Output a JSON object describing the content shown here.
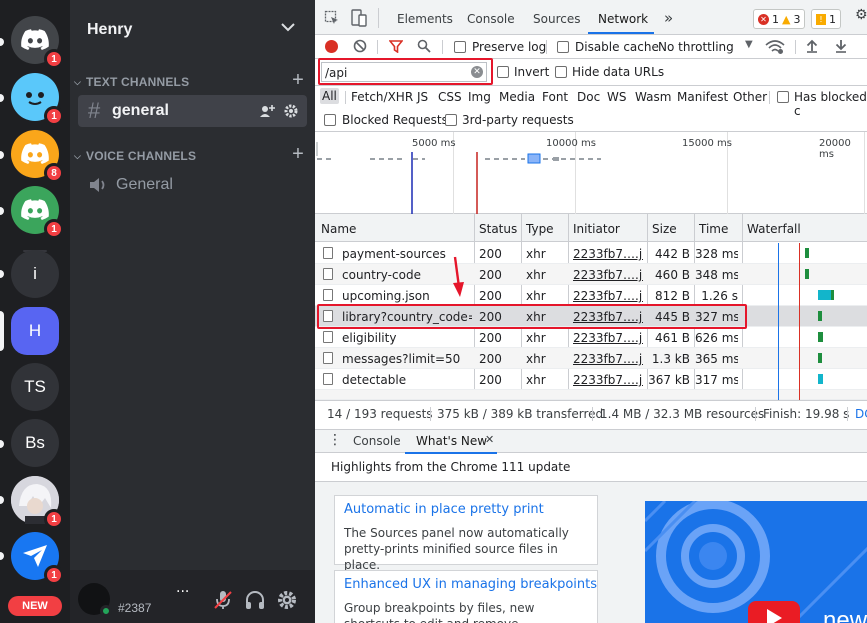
{
  "colors": {
    "discord_rail": "#1e1f22",
    "discord_sidebar": "#2b2d31",
    "discord_blurple": "#5865f2",
    "badge_red": "#f23f43",
    "devtools_accent": "#1a73e8",
    "annotation_red": "#e5162b"
  },
  "servers": [
    {
      "kind": "discord-logo",
      "color": "#424549",
      "badge": "1"
    },
    {
      "kind": "smiley",
      "color": "#5ac8fa",
      "badge": "1"
    },
    {
      "kind": "discord-logo",
      "color": "#faa61a",
      "badge": "8"
    },
    {
      "kind": "discord-logo",
      "color": "#3ba55c",
      "badge": "1"
    },
    {
      "kind": "text",
      "label": "i",
      "color": "#313338"
    },
    {
      "kind": "text",
      "label": "H",
      "color": "#5865f2",
      "selected": true
    },
    {
      "kind": "text",
      "label": "TS",
      "color": "#313338"
    },
    {
      "kind": "text",
      "label": "Bs",
      "color": "#313338"
    },
    {
      "kind": "anime-avatar",
      "color": "#c8c8d0",
      "badge": "1"
    },
    {
      "kind": "bird-logo",
      "color": "#1877f2",
      "badge": "1"
    }
  ],
  "new_label": "NEW",
  "guild": {
    "name": "Henry"
  },
  "categories": {
    "text": "TEXT CHANNELS",
    "voice": "VOICE CHANNELS"
  },
  "channels": {
    "text": "general",
    "voice": "General"
  },
  "user": {
    "tag": "#2387",
    "more": "···"
  },
  "devtools": {
    "tabs": [
      "Elements",
      "Console",
      "Sources",
      "Network"
    ],
    "more_tabs": "»",
    "counters": {
      "errors": "1",
      "warnings": "3",
      "info": "1"
    },
    "toolbar": {
      "preserve_log": "Preserve log",
      "disable_cache": "Disable cache",
      "throttling": "No throttling"
    },
    "filter": {
      "value": "/api",
      "invert": "Invert",
      "hide_data_urls": "Hide data URLs"
    },
    "types": [
      "All",
      "Fetch/XHR",
      "JS",
      "CSS",
      "Img",
      "Media",
      "Font",
      "Doc",
      "WS",
      "Wasm",
      "Manifest",
      "Other"
    ],
    "has_blocked": "Has blocked c",
    "blocked_requests": "Blocked Requests",
    "third_party": "3rd-party requests",
    "overview_ticks": [
      "5000 ms",
      "10000 ms",
      "15000 ms",
      "20000 ms"
    ],
    "columns": [
      "Name",
      "Status",
      "Type",
      "Initiator",
      "Size",
      "Time",
      "Waterfall"
    ],
    "rows": [
      {
        "name": "payment-sources",
        "status": "200",
        "type": "xhr",
        "initiator": "2233fb7….j…",
        "size": "442 B",
        "time": "328 ms"
      },
      {
        "name": "country-code",
        "status": "200",
        "type": "xhr",
        "initiator": "2233fb7….j…",
        "size": "460 B",
        "time": "348 ms"
      },
      {
        "name": "upcoming.json",
        "status": "200",
        "type": "xhr",
        "initiator": "2233fb7….j…",
        "size": "812 B",
        "time": "1.26 s"
      },
      {
        "name": "library?country_code=…",
        "status": "200",
        "type": "xhr",
        "initiator": "2233fb7….j…",
        "size": "445 B",
        "time": "327 ms"
      },
      {
        "name": "eligibility",
        "status": "200",
        "type": "xhr",
        "initiator": "2233fb7….j…",
        "size": "461 B",
        "time": "626 ms"
      },
      {
        "name": "messages?limit=50",
        "status": "200",
        "type": "xhr",
        "initiator": "2233fb7….j…",
        "size": "1.3 kB",
        "time": "365 ms"
      },
      {
        "name": "detectable",
        "status": "200",
        "type": "xhr",
        "initiator": "2233fb7….j…",
        "size": "367 kB",
        "time": "317 ms"
      }
    ],
    "status": {
      "requests": "14 / 193 requests",
      "transferred": "375 kB / 389 kB transferred",
      "resources": "1.4 MB / 32.3 MB resources",
      "finish": "Finish: 19.98 s",
      "more": "DC"
    },
    "drawer": {
      "console": "Console",
      "whats_new": "What's New"
    },
    "highlights": "Highlights from the Chrome 111 update",
    "cards": [
      {
        "title": "Automatic in place pretty print",
        "desc": "The Sources panel now automatically pretty-prints minified source files in place."
      },
      {
        "title": "Enhanced UX in managing breakpoints",
        "desc": "Group breakpoints by files, new shortcuts to edit and remove breakpoints, and more."
      }
    ],
    "promo_text": "new"
  }
}
